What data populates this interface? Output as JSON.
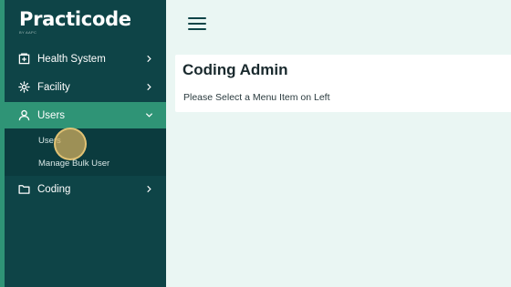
{
  "brand": {
    "name": "Practicode",
    "sub": "BY AAPC"
  },
  "sidebar": {
    "items": [
      {
        "label": "Health System",
        "icon": "hospital-icon"
      },
      {
        "label": "Facility",
        "icon": "gear-icon"
      },
      {
        "label": "Users",
        "icon": "user-icon"
      },
      {
        "label": "Coding",
        "icon": "folder-icon"
      }
    ],
    "submenu": [
      {
        "label": "Users"
      },
      {
        "label": "Manage Bulk User"
      }
    ]
  },
  "header": {
    "menu_icon": "hamburger-icon"
  },
  "main": {
    "title": "Coding Admin",
    "message": "Please Select a Menu Item on Left"
  },
  "colors": {
    "sidebar_bg": "#0e4447",
    "accent": "#2f9476",
    "page_bg": "#eaf6f3"
  }
}
